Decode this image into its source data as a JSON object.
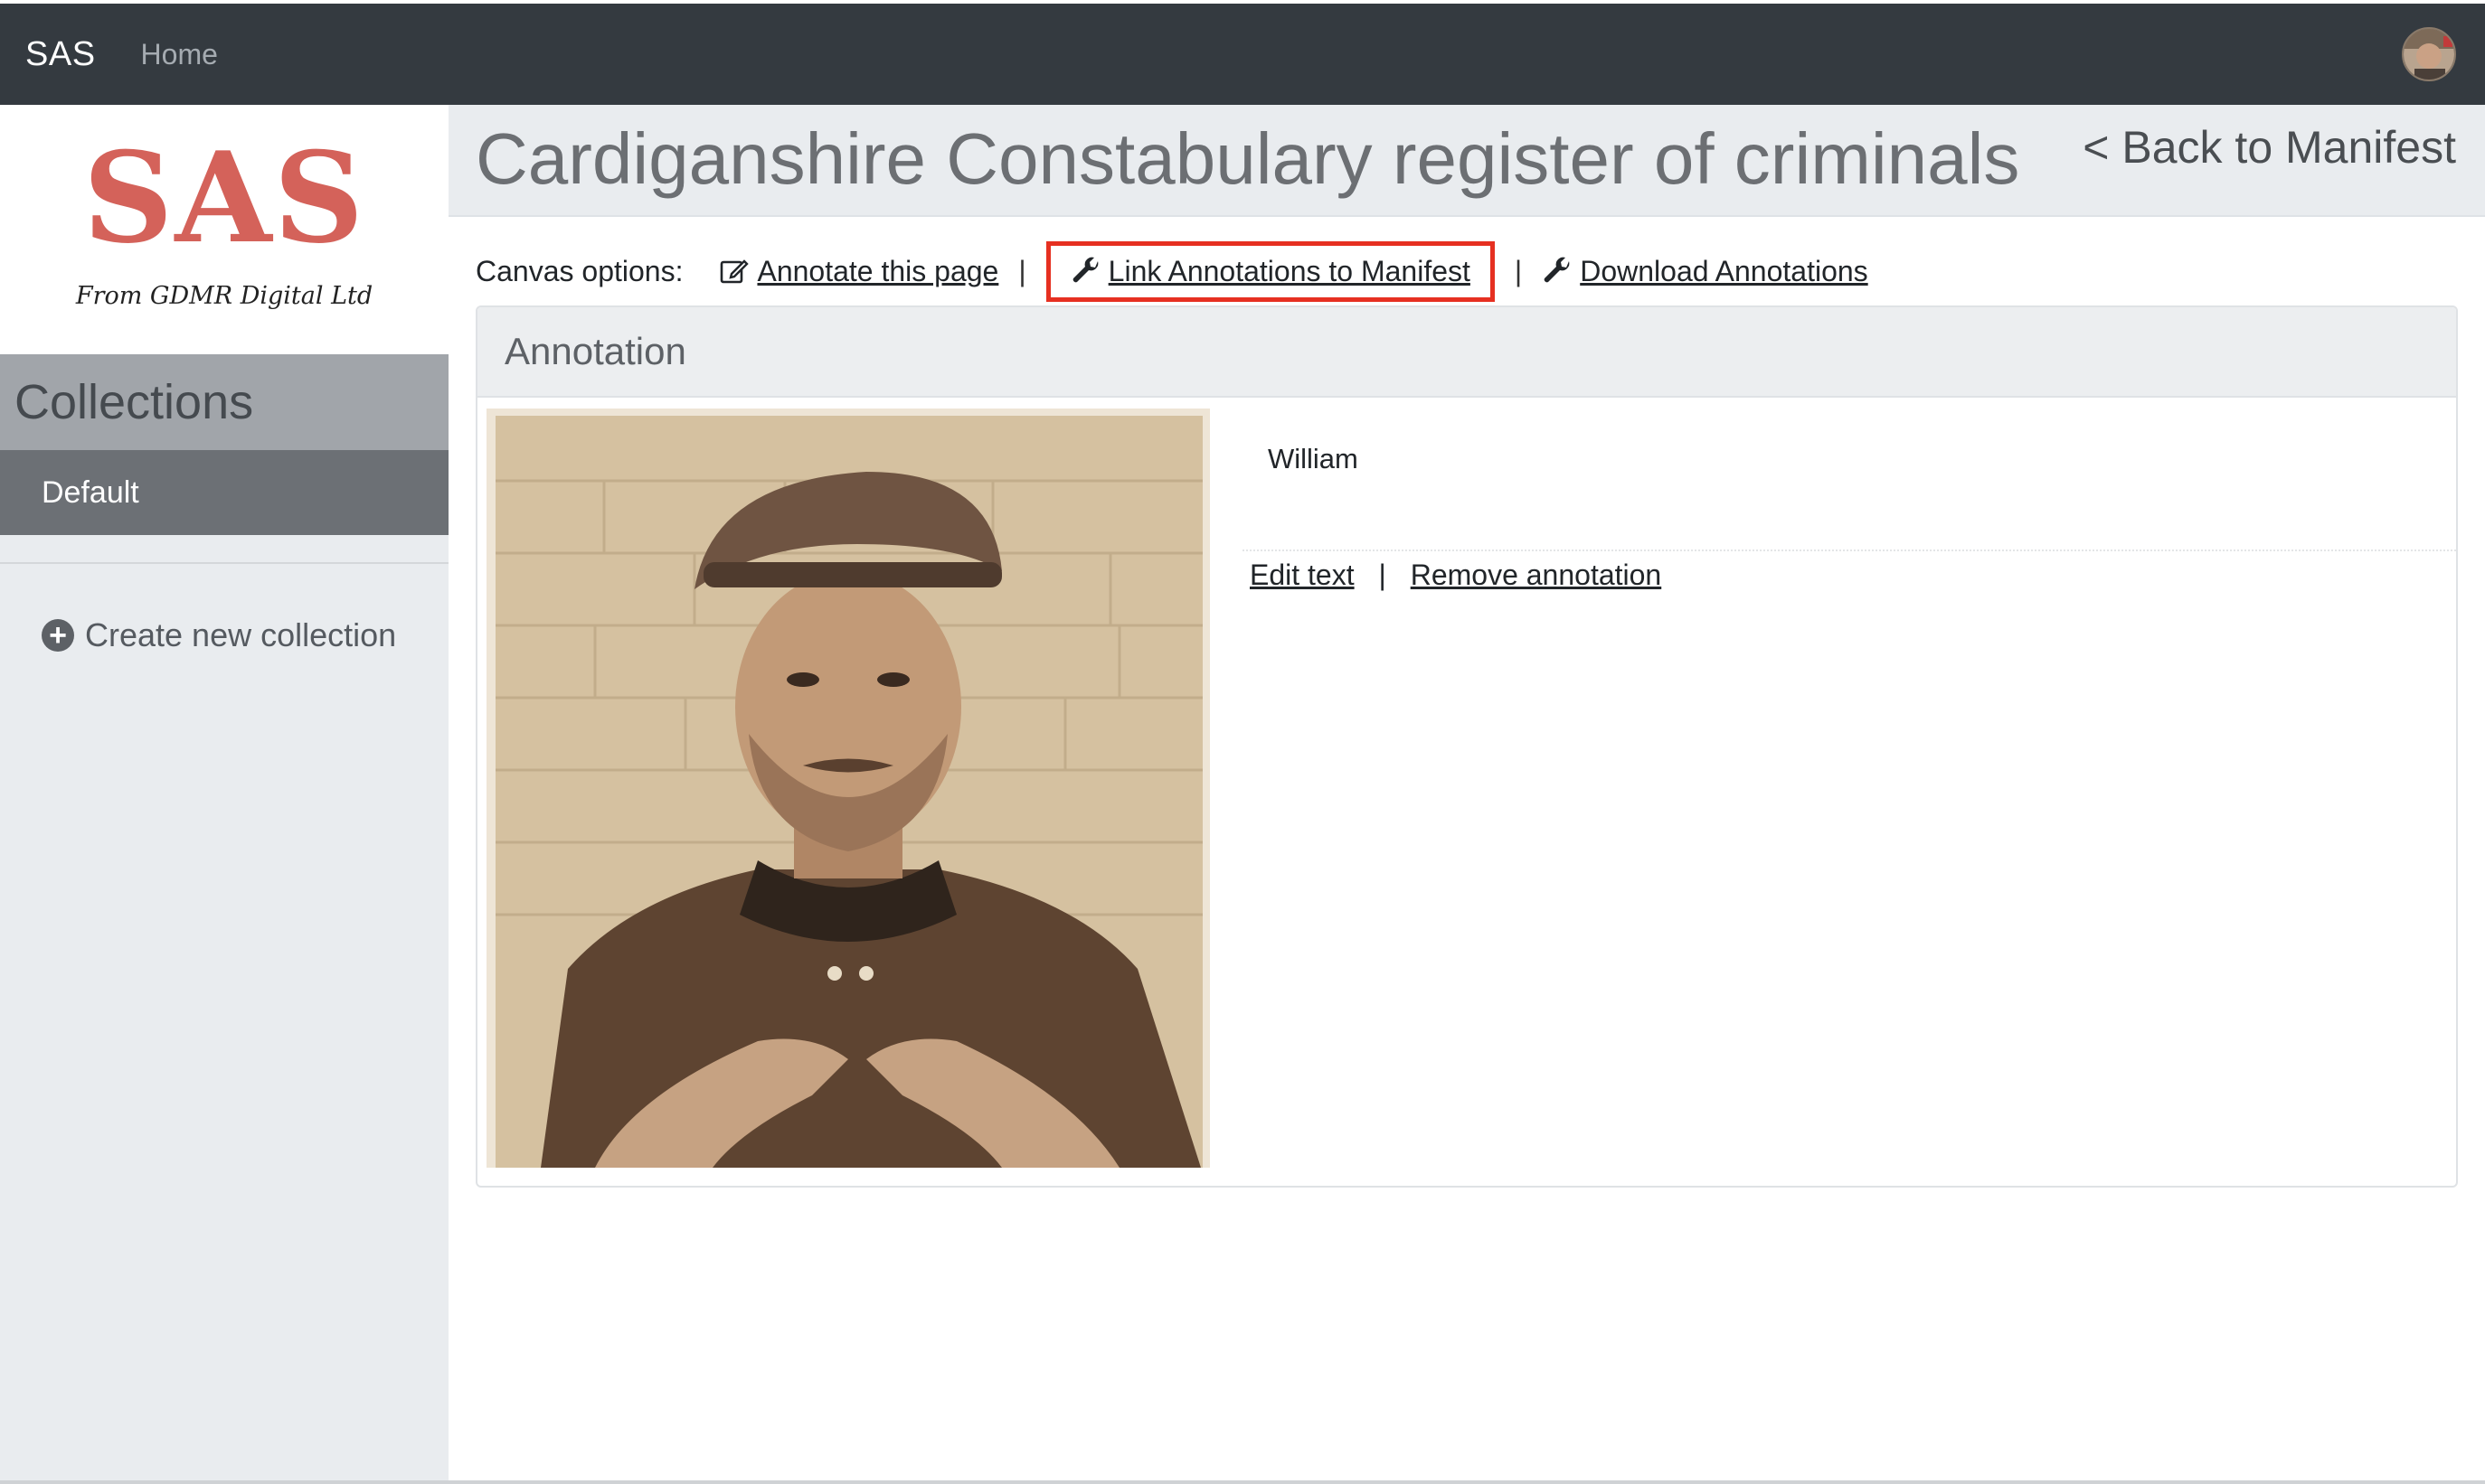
{
  "navbar": {
    "brand": "SAS",
    "home_label": "Home"
  },
  "sidebar": {
    "logo": {
      "text": "SAS",
      "subtitle": "From GDMR Digital Ltd"
    },
    "collections_heading": "Collections",
    "items": [
      {
        "label": "Default",
        "active": true
      }
    ],
    "create_label": "Create new collection"
  },
  "main": {
    "title": "Cardiganshire Constabulary register of criminals",
    "back_label": "< Back to Manifest",
    "canvas_options": {
      "label": "Canvas options:",
      "annotate_label": "Annotate this page",
      "link_label": "Link Annotations to Manifest",
      "download_label": "Download Annotations",
      "separator": "|"
    },
    "annotation": {
      "header": "Annotation",
      "text": "William",
      "edit_label": "Edit text",
      "remove_label": "Remove annotation",
      "separator": "|"
    }
  },
  "colors": {
    "navbar_bg": "#343a40",
    "logo_red": "#d4625a",
    "highlight_red": "#e63021",
    "sidebar_bg": "#e9ecef",
    "active_item_bg": "#6c7075"
  },
  "icons": [
    "user-avatar",
    "plus-circle-icon",
    "edit-icon",
    "wrench-icon"
  ]
}
